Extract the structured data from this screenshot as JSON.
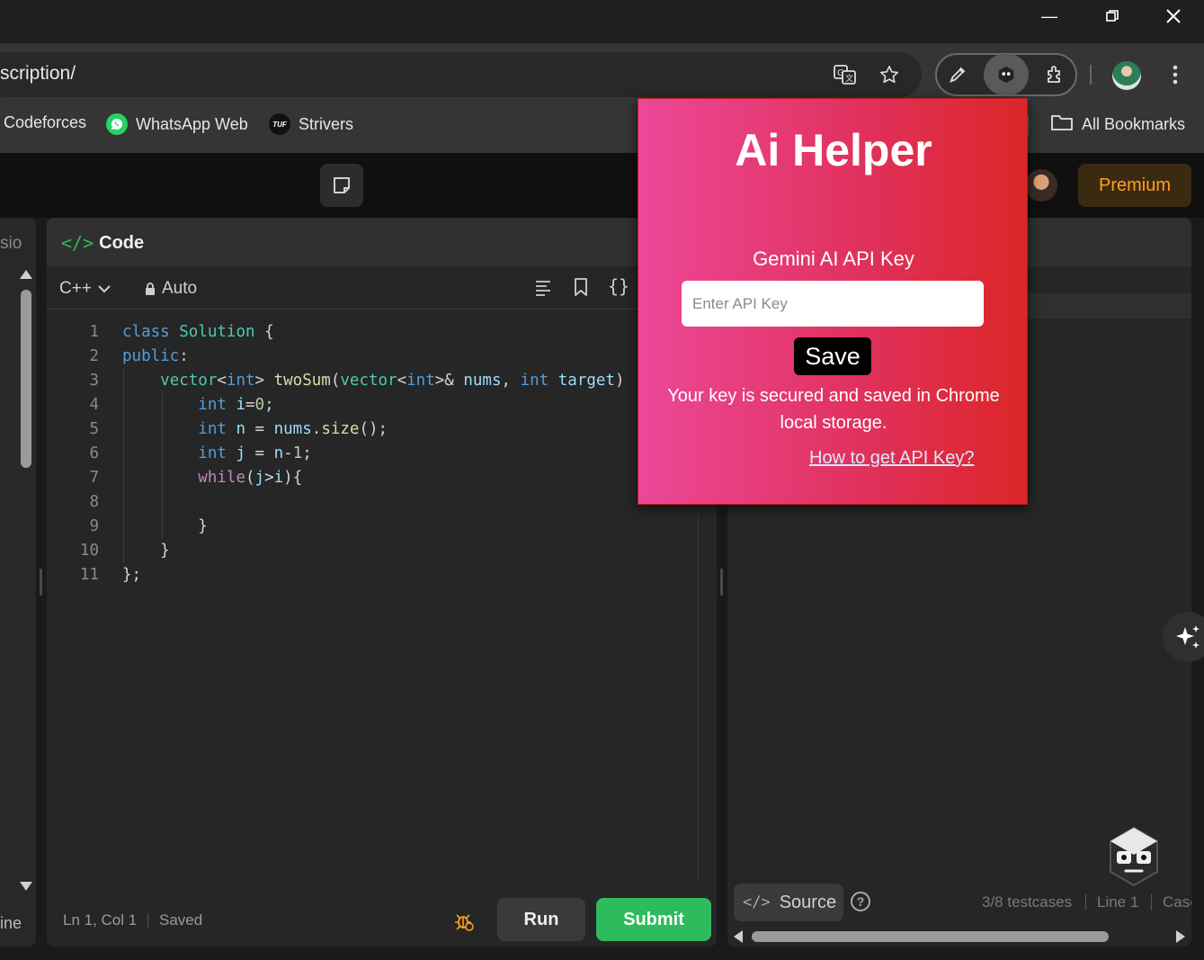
{
  "browser": {
    "url_fragment": "scription/",
    "window_controls": [
      "minimize",
      "restore",
      "close"
    ]
  },
  "bookmarks": [
    {
      "label": "Codeforces"
    },
    {
      "label": "WhatsApp Web"
    },
    {
      "label": "Strivers",
      "icon_text": "TUF"
    }
  ],
  "all_bookmarks_label": "All Bookmarks",
  "header": {
    "premium_label": "Premium"
  },
  "left_panel": {
    "top_text": "sio",
    "bottom_text": "ine"
  },
  "code_panel": {
    "title": "Code",
    "language": "C++",
    "mode": "Auto",
    "lines": [
      "1",
      "2",
      "3",
      "4",
      "5",
      "6",
      "7",
      "8",
      "9",
      "10",
      "11"
    ],
    "status_position": "Ln 1, Col 1",
    "status_saved": "Saved",
    "run_label": "Run",
    "submit_label": "Submit"
  },
  "right_panel": {
    "source_label": "Source",
    "testcases": "3/8 testcases",
    "line_label": "Line 1",
    "case_label": "Case"
  },
  "popup": {
    "title": "Ai Helper",
    "api_label": "Gemini AI API Key",
    "input_placeholder": "Enter API Key",
    "input_value": "",
    "save_label": "Save",
    "note": "Your key is secured and saved in Chrome local storage.",
    "link_label": "How to get API Key?"
  },
  "colors": {
    "accent_green": "#2cbb5d",
    "premium_orange": "#ffa116",
    "popup_gradient_start": "#ec4899",
    "popup_gradient_end": "#dc2626"
  }
}
